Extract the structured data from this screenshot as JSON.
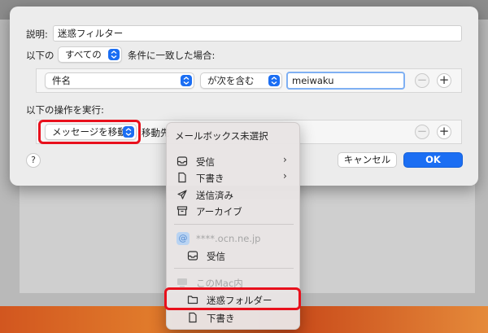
{
  "colors": {
    "accent": "#1b6ef3",
    "highlight": "#e8101c"
  },
  "rule": {
    "description_label": "説明:",
    "description_value": "迷惑フィルター",
    "match_prefix": "以下の",
    "match_mode": "すべての",
    "match_suffix": "条件に一致した場合:",
    "condition": {
      "field": "件名",
      "operator": "が次を含む",
      "value": "meiwaku"
    },
    "actions_label": "以下の操作を実行:",
    "action": {
      "type": "メッセージを移動",
      "destination_prefix": "移動先"
    },
    "remove_symbol": "−",
    "add_symbol": "+",
    "help_label": "?",
    "cancel_label": "キャンセル",
    "ok_label": "OK"
  },
  "mailbox_menu": {
    "header": "メールボックス未選択",
    "local_items": [
      {
        "label": "受信",
        "icon": "tray-icon",
        "has_submenu": true
      },
      {
        "label": "下書き",
        "icon": "document-icon",
        "has_submenu": true
      },
      {
        "label": "送信済み",
        "icon": "paperplane-icon",
        "has_submenu": false
      },
      {
        "label": "アーカイブ",
        "icon": "archive-box-icon",
        "has_submenu": false
      }
    ],
    "account": {
      "name": "****.ocn.ne.jp",
      "icon": "at-icon",
      "inbox_label": "受信"
    },
    "on_my_mac": {
      "header": "このMac内",
      "folders": [
        {
          "label": "迷惑フォルダー",
          "icon": "folder-icon",
          "highlighted": true
        },
        {
          "label": "下書き",
          "icon": "document-icon",
          "highlighted": false
        }
      ]
    },
    "submenu_arrow": "›",
    "at_symbol": "@"
  }
}
